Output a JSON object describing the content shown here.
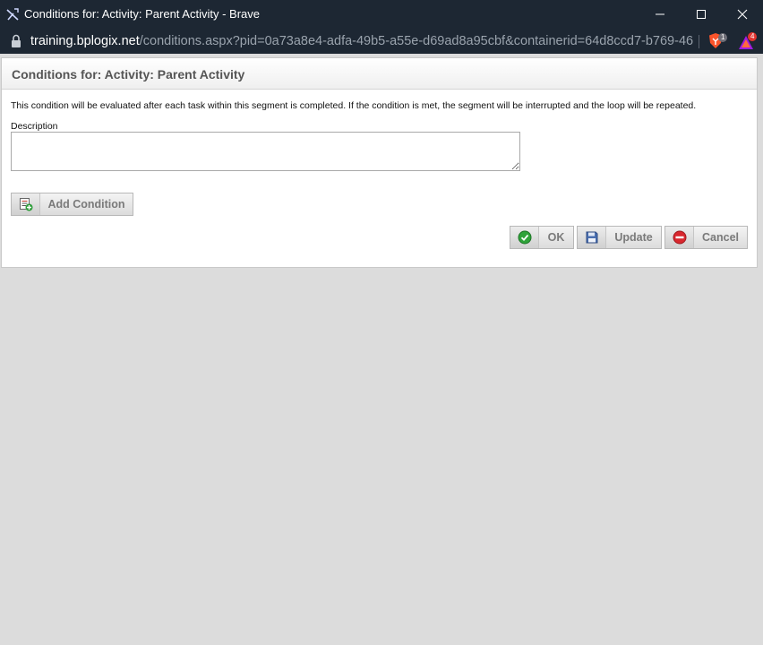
{
  "window": {
    "title": "Conditions for: Activity: Parent Activity - Brave",
    "icons": [
      "app-logo-icon",
      "minimize-icon",
      "maximize-icon",
      "close-icon"
    ]
  },
  "address_bar": {
    "host": "training.bplogix.net",
    "path": "/conditions.aspx?pid=0a73a8e4-adfa-49b5-a55e-d69ad8a95cbf&containerid=64d8ccd7-b769-46...",
    "shield_count": "1",
    "rewards_count": "4",
    "colors": {
      "shield": "#fb542b",
      "rewards": "#e3342f"
    }
  },
  "dialog": {
    "title": "Conditions for: Activity: Parent Activity",
    "info": "This condition will be evaluated after each task within this segment is completed. If the condition is met, the segment will be interrupted and the loop will be repeated.",
    "description_label": "Description",
    "description_value": "",
    "add_condition_label": "Add Condition",
    "ok_label": "OK",
    "update_label": "Update",
    "cancel_label": "Cancel"
  }
}
